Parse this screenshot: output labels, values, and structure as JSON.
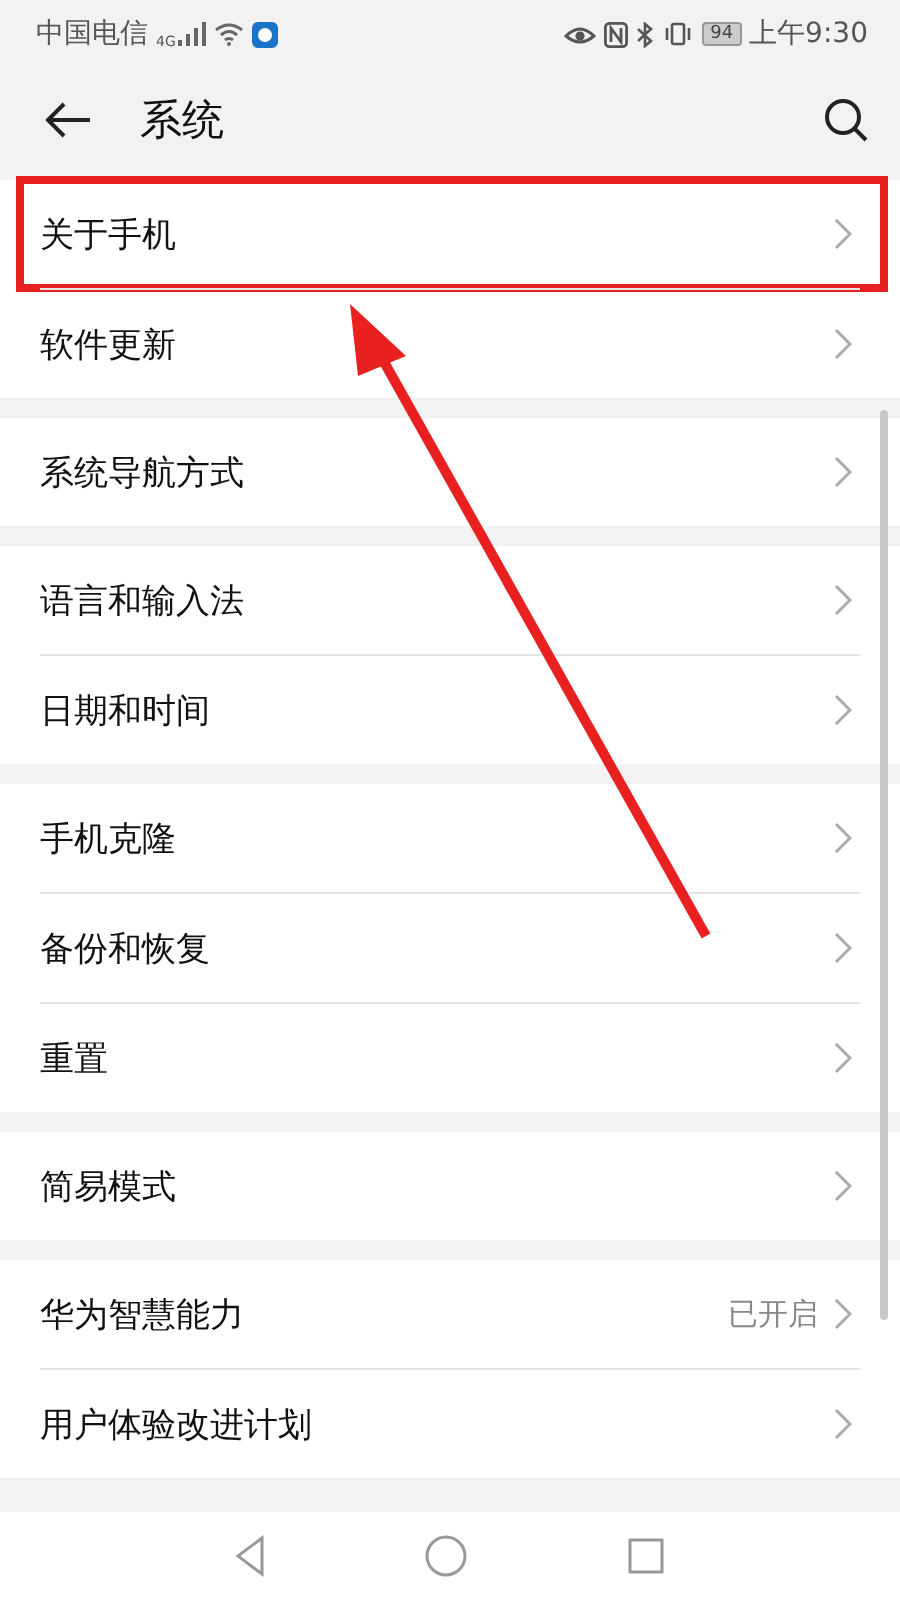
{
  "status_bar": {
    "carrier": "中国电信",
    "network": "4G",
    "battery": "94",
    "time": "上午9:30"
  },
  "header": {
    "title": "系统"
  },
  "groups": [
    {
      "items": [
        {
          "label": "关于手机",
          "highlighted": true
        },
        {
          "label": "软件更新",
          "highlighted": false
        }
      ]
    },
    {
      "items": [
        {
          "label": "系统导航方式",
          "highlighted": false
        }
      ]
    },
    {
      "items": [
        {
          "label": "语言和输入法",
          "highlighted": false
        },
        {
          "label": "日期和时间",
          "highlighted": false
        }
      ]
    },
    {
      "items": [
        {
          "label": "手机克隆",
          "highlighted": false
        },
        {
          "label": "备份和恢复",
          "highlighted": false
        },
        {
          "label": "重置",
          "highlighted": false
        }
      ]
    },
    {
      "items": [
        {
          "label": "简易模式",
          "highlighted": false
        }
      ]
    },
    {
      "items": [
        {
          "label": "华为智慧能力",
          "value": "已开启",
          "highlighted": false
        },
        {
          "label": "用户体验改进计划",
          "highlighted": false
        }
      ]
    }
  ]
}
